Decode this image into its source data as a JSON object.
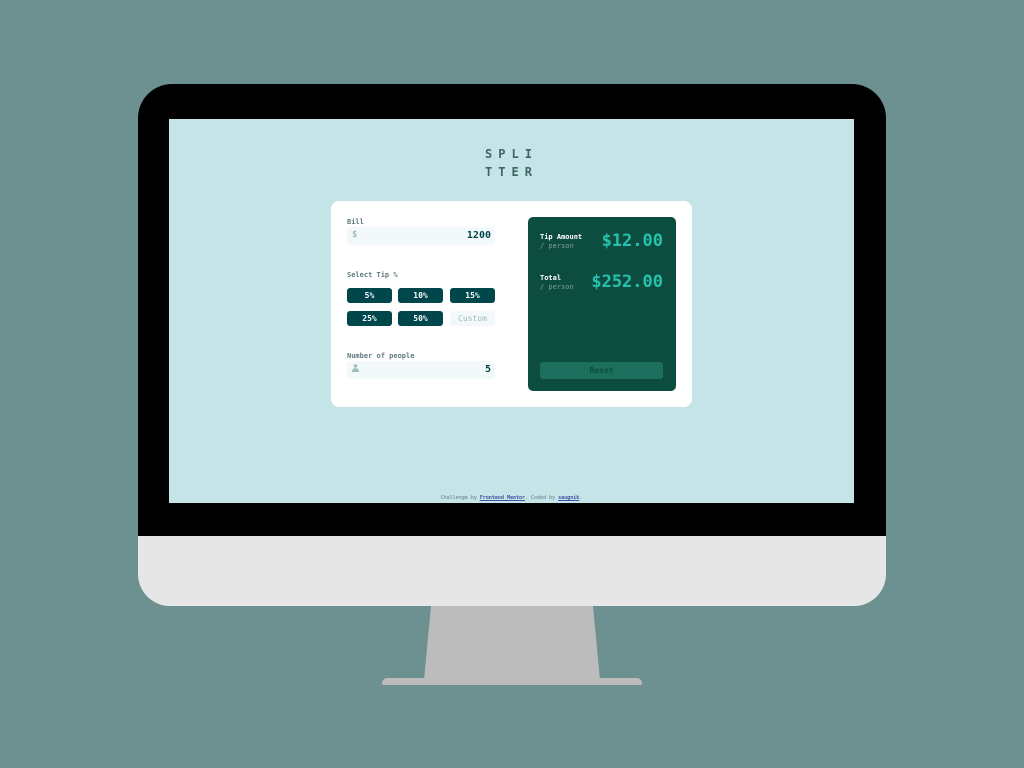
{
  "app": {
    "logo_line1": "SPLI",
    "logo_line2": "TTER"
  },
  "form": {
    "bill_label": "Bill",
    "bill_prefix": "$",
    "bill_value": "1200",
    "tip_label": "Select Tip %",
    "tips": [
      "5%",
      "10%",
      "15%",
      "25%",
      "50%"
    ],
    "custom_placeholder": "Custom",
    "people_label": "Number of people",
    "people_value": "5"
  },
  "results": {
    "tip_label": "Tip Amount",
    "tip_sub": "/ person",
    "tip_amount": "$12.00",
    "total_label": "Total",
    "total_sub": "/ person",
    "total_amount": "$252.00",
    "reset_label": "Reset"
  },
  "footer": {
    "prefix": "Challenge by ",
    "fm_link": "Frontend Mentor",
    "middle": ". Coded by ",
    "author_link": "saugnik",
    "suffix": "."
  },
  "colors": {
    "background": "#6d9190",
    "screen": "#c5e4e7",
    "accent": "#26c2ad",
    "dark": "#00474b"
  },
  "icons": {
    "bill": "dollar-icon",
    "people": "person-icon"
  }
}
